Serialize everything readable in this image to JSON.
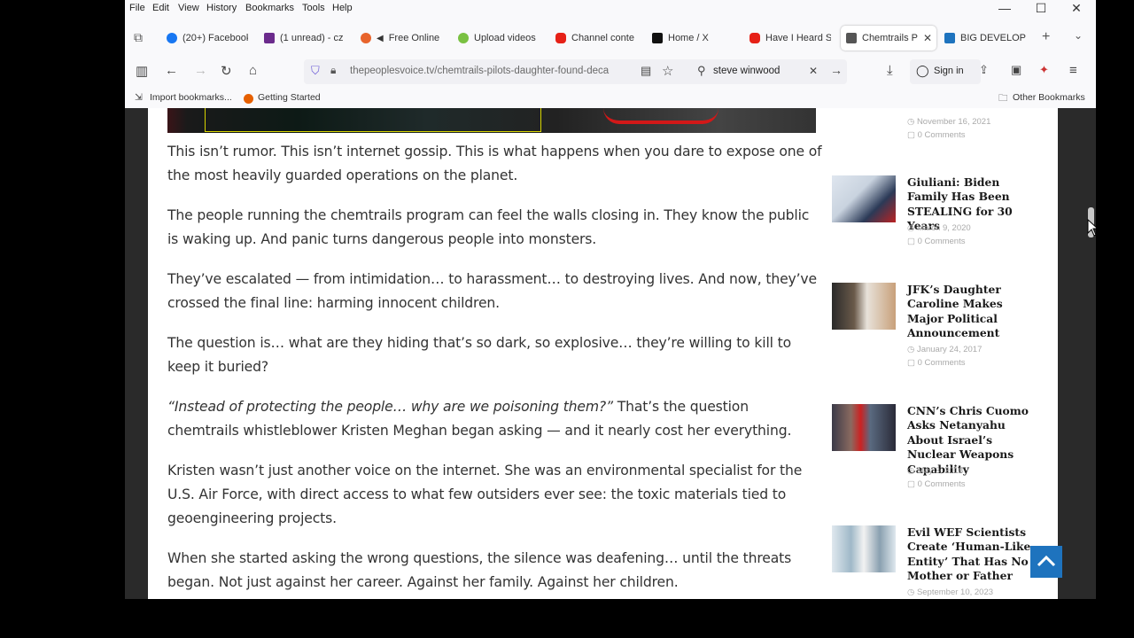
{
  "menu": [
    "File",
    "Edit",
    "View",
    "History",
    "Bookmarks",
    "Tools",
    "Help"
  ],
  "window_controls": {
    "minimize": "—",
    "maximize": "☐",
    "close": "✕"
  },
  "tabs": [
    {
      "label": "(20+) Facebook",
      "color": "#1877f2"
    },
    {
      "label": "(1 unread) - cz",
      "color": "#6b2b8c"
    },
    {
      "label": "Free Online",
      "color": "#e8642c"
    },
    {
      "label": "Upload videos",
      "color": "#7ac142"
    },
    {
      "label": "Channel conte",
      "color": "#e62117"
    },
    {
      "label": "Home / X",
      "color": "#111111"
    },
    {
      "label": "Have I Heard S",
      "color": "#e62117"
    },
    {
      "label": "Chemtrails P",
      "color": "#555555"
    },
    {
      "label": "BIG DEVELOPM",
      "color": "#1e73be"
    }
  ],
  "url": "thepeoplesvoice.tv/chemtrails-pilots-daughter-found-deca",
  "search_value": "steve winwood",
  "signin_label": "Sign in",
  "bookmarks": {
    "import": "Import bookmarks...",
    "getting_started": "Getting Started",
    "other": "Other Bookmarks"
  },
  "article": {
    "p1": "This isn’t rumor. This isn’t internet gossip. This is what happens when you dare to expose one of the most heavily guarded operations on the planet.",
    "p2": "The people running the chemtrails program can feel the walls closing in. They know the public is waking up. And panic turns dangerous people into monsters.",
    "p3": "They’ve escalated — from intimidation… to harassment… to destroying lives. And now, they’ve crossed the final line: harming innocent children.",
    "p4": "The question is… what are they hiding that’s so dark, so explosive… they’re willing to kill to keep it buried?",
    "p5_quote": "“Instead of protecting the people… why are we poisoning them?”",
    "p5_rest": " That’s the question chemtrails whistleblower Kristen Meghan began asking — and it nearly cost her everything.",
    "p6": "Kristen wasn’t just another voice on the internet. She was an environmental specialist for the U.S. Air Force, with direct access to what few outsiders ever see: the toxic materials tied to geoengineering projects.",
    "p7": "When she started asking the wrong questions, the silence was deafening… until the threats began. Not just against her career. Against her family. Against her children."
  },
  "sidebar": {
    "top_date": "November 16, 2021",
    "top_comments": "0 Comments",
    "items": [
      {
        "title": "Giuliani: Biden Family Has Been STEALING for 30 Years",
        "date": "March 9, 2020",
        "comments": "0 Comments"
      },
      {
        "title": "JFK’s Daughter Caroline Makes Major Political Announcement",
        "date": "January 24, 2017",
        "comments": "0 Comments"
      },
      {
        "title": "CNN’s Chris Cuomo Asks Netanyahu About Israel’s Nuclear Weapons Capability",
        "date": "May 3, 2018",
        "comments": "0 Comments"
      },
      {
        "title": "Evil WEF Scientists Create ‘Human-Like Entity’ That Has No Mother or Father",
        "date": "September 10, 2023",
        "comments": ""
      }
    ]
  },
  "colors": {
    "accent": "#1e73be",
    "highlight_border": "#d8d400",
    "red_circle": "#d21818"
  },
  "icons": [
    "library-icon",
    "back-arrow-icon",
    "forward-arrow-icon",
    "reload-icon",
    "home-icon",
    "shield-icon",
    "lock-icon",
    "reader-icon",
    "star-icon",
    "search-icon",
    "clear-icon",
    "go-arrow-icon",
    "download-icon",
    "account-icon",
    "share-icon",
    "extensions-icon",
    "menu-icon",
    "chevron-up-icon"
  ]
}
